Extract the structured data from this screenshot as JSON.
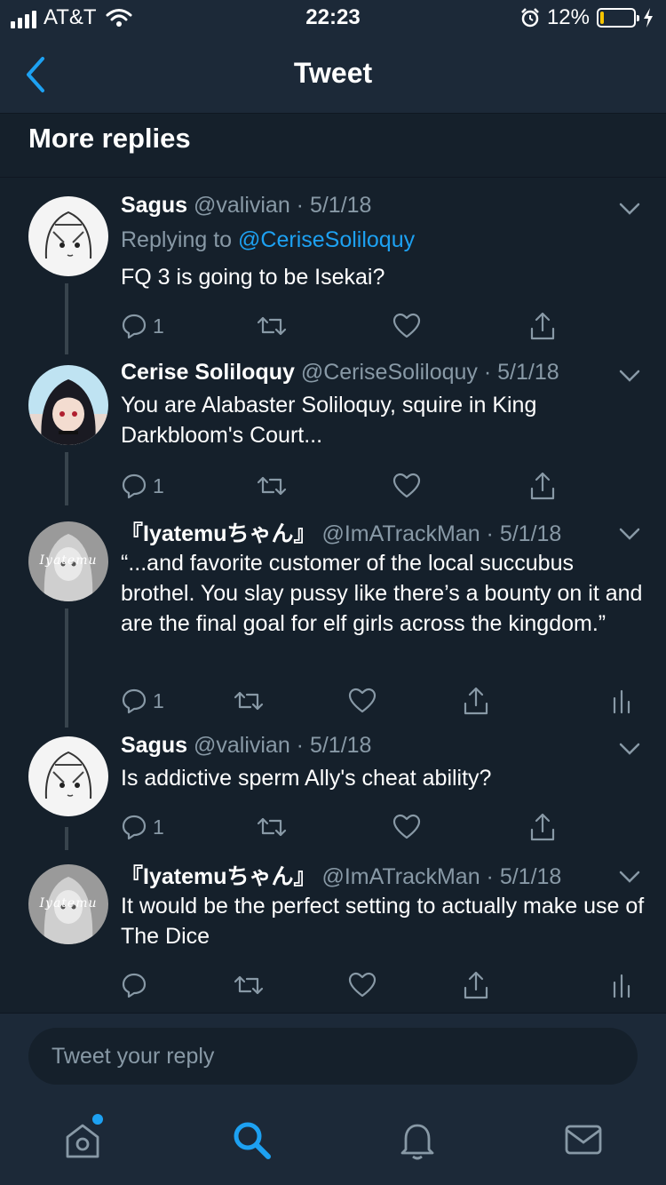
{
  "status_bar": {
    "carrier": "AT&T",
    "time": "22:23",
    "battery_percent": "12%",
    "battery_level": 0.12,
    "colors": {
      "battery_fill": "#f5c400"
    }
  },
  "nav": {
    "title": "Tweet",
    "back_icon": "chevron-left-icon"
  },
  "section": {
    "title": "More replies"
  },
  "tweets": [
    {
      "name": "Sagus",
      "meta": "@valivian · 5/1/18",
      "replying_prefix": "Replying to ",
      "replying_handle": "@CeriseSoliloquy",
      "text": "FQ 3 is going to be Isekai?",
      "reply_count": "1",
      "avatar": "anime-sketch-avatar"
    },
    {
      "name": "Cerise Soliloquy",
      "meta": "@CeriseSoliloquy · 5/1/18",
      "text": "You are Alabaster Soliloquy, squire in King Darkbloom's Court...",
      "reply_count": "1",
      "avatar": "dark-hair-anime-avatar"
    },
    {
      "name": "『Iyatemuちゃん』",
      "meta": "@ImATrackMan · 5/1/18",
      "text": "“...and favorite customer of the local succubus brothel. You slay pussy like there’s a bounty on it and are the final goal for elf girls across the kingdom.”",
      "reply_count": "1",
      "avatar": "grey-anime-avatar"
    },
    {
      "name": "Sagus",
      "meta": "@valivian · 5/1/18",
      "text": "Is addictive sperm Ally's cheat ability?",
      "reply_count": "1",
      "avatar": "anime-sketch-avatar"
    },
    {
      "name": "『Iyatemuちゃん』",
      "meta": "@ImATrackMan · 5/1/18",
      "text": "It would be the perfect setting to actually make use of The Dice",
      "reply_count": "",
      "avatar": "grey-anime-avatar"
    }
  ],
  "avatar_watermark": "Iyatemu",
  "reply_bar": {
    "placeholder": "Tweet your reply"
  },
  "tabs": [
    {
      "name": "home",
      "icon": "home-icon",
      "has_notification_dot": true
    },
    {
      "name": "search",
      "icon": "search-icon",
      "active": true
    },
    {
      "name": "notifications",
      "icon": "bell-icon"
    },
    {
      "name": "messages",
      "icon": "mail-icon"
    }
  ],
  "colors": {
    "background": "#15202b",
    "bar": "#1c2938",
    "accent": "#1da1f2",
    "secondary_text": "#8899a6"
  }
}
